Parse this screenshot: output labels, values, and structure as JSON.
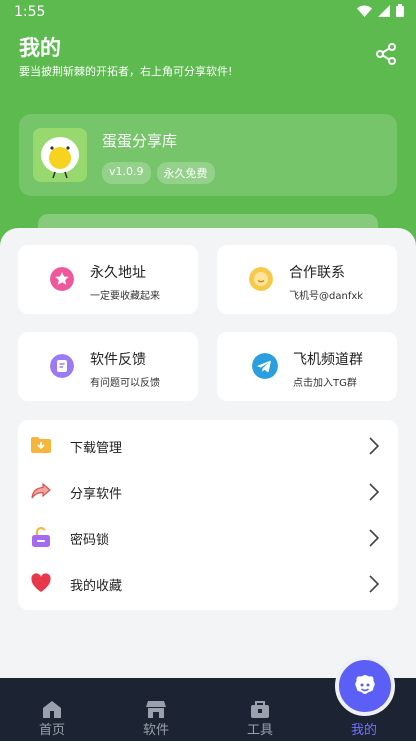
{
  "status": {
    "time": "1:55"
  },
  "header": {
    "title": "我的",
    "subtitle": "要当披荆斩棘的开拓者，右上角可分享软件!",
    "share_icon": "share-icon"
  },
  "app": {
    "name": "蛋蛋分享库",
    "version": "v1.0.9",
    "tag": "永久免费"
  },
  "tiles": [
    {
      "title": "永久地址",
      "sub": "一定要收藏起来",
      "icon": "star-icon",
      "color": "#f0589b"
    },
    {
      "title": "合作联系",
      "sub": "飞机号@danfxk",
      "icon": "smile-icon",
      "color": "#f7c94a"
    },
    {
      "title": "软件反馈",
      "sub": "有问题可以反馈",
      "icon": "feedback-icon",
      "color": "#9b7bf5"
    },
    {
      "title": "飞机频道群",
      "sub": "点击加入TG群",
      "icon": "telegram-icon",
      "color": "#2a9fe0"
    }
  ],
  "menu": [
    {
      "label": "下载管理",
      "icon": "download-folder-icon"
    },
    {
      "label": "分享软件",
      "icon": "share-arrow-icon"
    },
    {
      "label": "密码锁",
      "icon": "lock-icon"
    },
    {
      "label": "我的收藏",
      "icon": "heart-icon"
    }
  ],
  "nav": [
    {
      "label": "首页",
      "icon": "home-icon"
    },
    {
      "label": "软件",
      "icon": "store-icon"
    },
    {
      "label": "工具",
      "icon": "toolbox-icon"
    },
    {
      "label": "我的",
      "icon": "profile-icon",
      "active": true
    }
  ],
  "colors": {
    "primary": "#5cba4f",
    "accent": "#5b5ff5",
    "nav_bg": "#1c2333"
  }
}
